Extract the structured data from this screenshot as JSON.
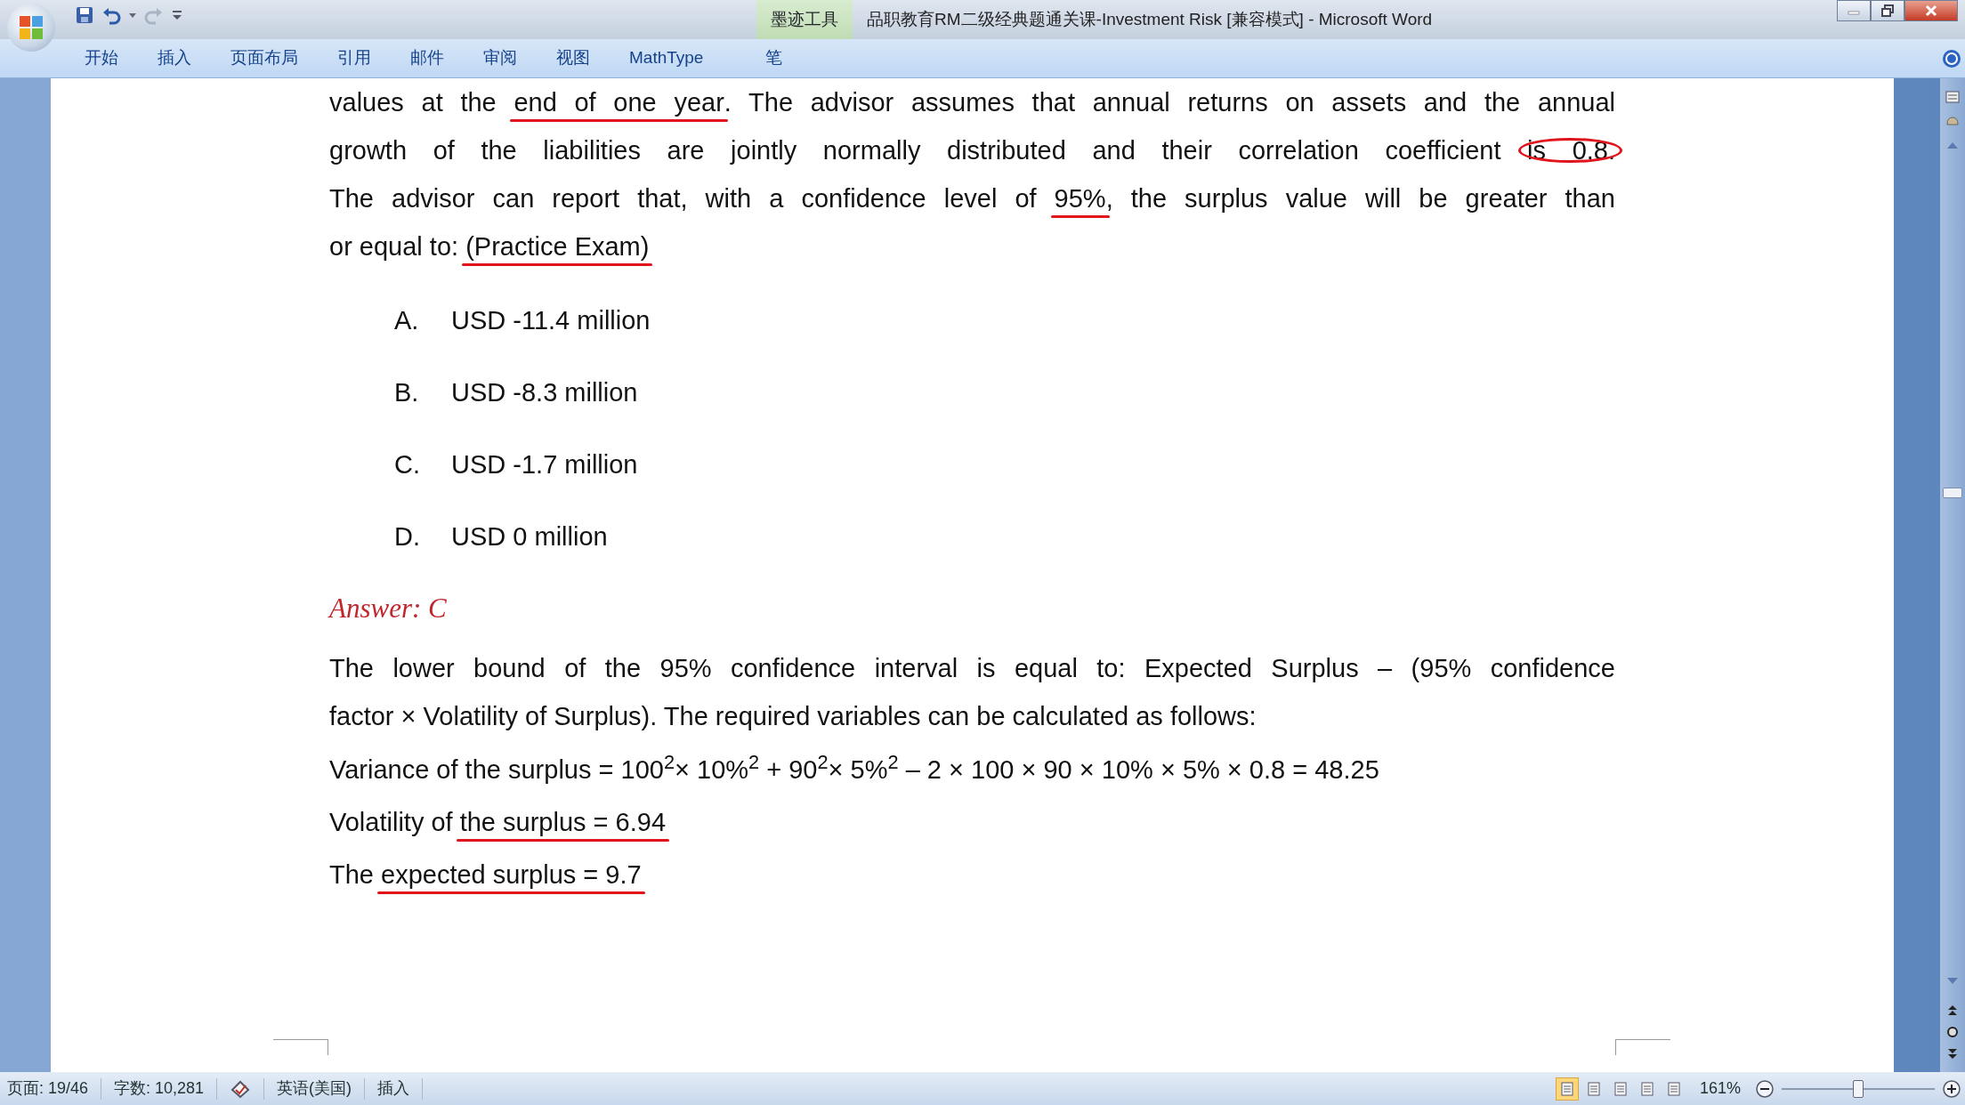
{
  "window": {
    "title": "品职教育RM二级经典题通关课-Investment Risk [兼容模式] - Microsoft Word",
    "context_tab_group": "墨迹工具"
  },
  "ribbon_tabs": [
    {
      "label": "开始",
      "selected": false
    },
    {
      "label": "插入",
      "selected": false
    },
    {
      "label": "页面布局",
      "selected": false
    },
    {
      "label": "引用",
      "selected": false
    },
    {
      "label": "邮件",
      "selected": false
    },
    {
      "label": "审阅",
      "selected": false
    },
    {
      "label": "视图",
      "selected": false
    },
    {
      "label": "MathType",
      "selected": false
    },
    {
      "label": "笔",
      "selected": false
    }
  ],
  "document": {
    "question_lines": [
      [
        {
          "text": "values at the ",
          "underlined": false,
          "circled": false
        },
        {
          "text": "end of one year",
          "underlined": true,
          "circled": false
        },
        {
          "text": ". The advisor assumes that annual returns on assets and the annual",
          "underlined": false,
          "circled": false
        }
      ],
      [
        {
          "text": "growth of the liabilities are jointly normally distributed and their correlation coefficient ",
          "underlined": false,
          "circled": false
        },
        {
          "text": "is 0.8.",
          "underlined": false,
          "circled": true
        }
      ],
      [
        {
          "text": "The advisor can report that, with a confidence level of ",
          "underlined": false,
          "circled": false
        },
        {
          "text": "95%",
          "underlined": true,
          "circled": false
        },
        {
          "text": ", the surplus value will be greater than",
          "underlined": false,
          "circled": false
        }
      ],
      [
        {
          "text": "or equal to: ",
          "underlined": false,
          "circled": false
        },
        {
          "text": "(Practice Exam)",
          "underlined": true,
          "circled": false
        }
      ]
    ],
    "options": [
      {
        "letter": "A.",
        "text": "USD -11.4 million"
      },
      {
        "letter": "B.",
        "text": "USD -8.3 million"
      },
      {
        "letter": "C.",
        "text": "USD -1.7 million"
      },
      {
        "letter": "D.",
        "text": "USD 0 million"
      }
    ],
    "answer": "Answer: C",
    "explanation_lines": [
      "The lower bound of the 95% confidence interval is equal to: Expected Surplus – (95% confidence",
      "factor × Volatility of Surplus). The required variables can be calculated as follows:"
    ],
    "formula": "Variance of the surplus = 100$^{2}$× 10%$^{2}$ + 90$^{2}$× 5%$^{2}$ – 2 × 100 × 90 × 10% × 5% × 0.8 = 48.25",
    "result_lines": [
      [
        {
          "text": "Volatility of ",
          "underlined": false,
          "circled": false
        },
        {
          "text": "the surplus = 6.94",
          "underlined": true,
          "circled": false
        }
      ],
      [
        {
          "text": "The ",
          "underlined": false,
          "circled": false
        },
        {
          "text": "expected surplus = 9.7",
          "underlined": true,
          "circled": false
        }
      ]
    ]
  },
  "status_bar": {
    "page": "页面: 19/46",
    "words": "字数: 10,281",
    "language": "英语(美国)",
    "mode": "插入",
    "views": [
      {
        "selected": true
      },
      {
        "selected": false
      },
      {
        "selected": false
      },
      {
        "selected": false
      },
      {
        "selected": false
      }
    ],
    "zoom": "161%",
    "zoom_slider": {
      "level": 0.5
    }
  }
}
